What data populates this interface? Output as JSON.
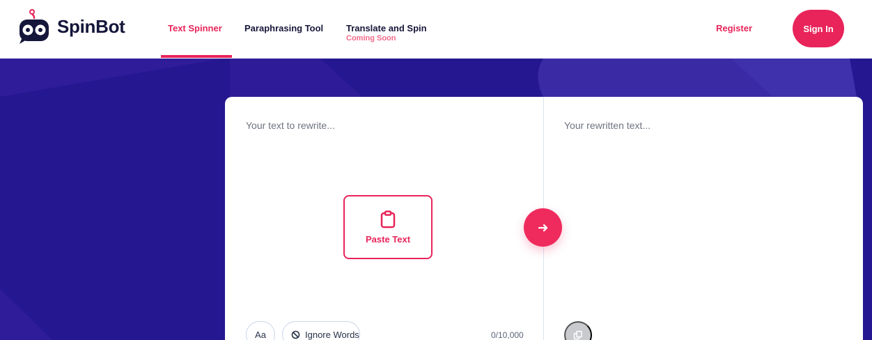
{
  "brand": {
    "name": "SpinBot"
  },
  "nav": {
    "items": [
      {
        "label": "Text Spinner",
        "active": true
      },
      {
        "label": "Paraphrasing Tool",
        "active": false
      },
      {
        "label": "Translate and Spin",
        "active": false,
        "badge": "Coming Soon"
      }
    ],
    "register_label": "Register",
    "signin_label": "Sign In"
  },
  "editor": {
    "input_placeholder": "Your text to rewrite...",
    "output_placeholder": "Your rewritten text...",
    "paste_label": "Paste Text",
    "case_label": "Aa",
    "ignore_words_label": "Ignore Words",
    "char_count": "0/10,000"
  },
  "colors": {
    "accent": "#e8245a",
    "hero_background": "#251790",
    "text_dark": "#16163a",
    "muted_text": "#6e7380"
  }
}
